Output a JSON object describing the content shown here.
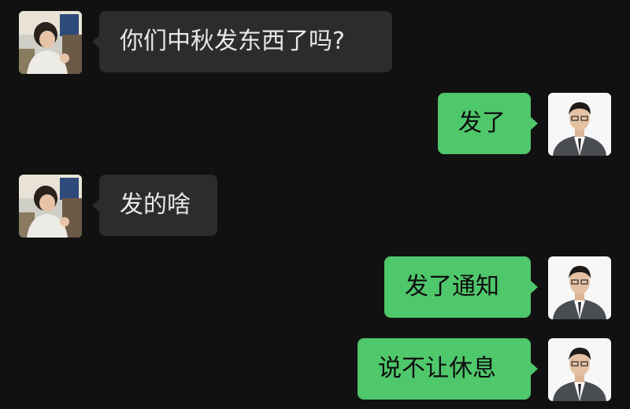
{
  "messages": [
    {
      "sender": "left",
      "text": "你们中秋发东西了吗?"
    },
    {
      "sender": "right",
      "text": "发了"
    },
    {
      "sender": "left",
      "text": "发的啥"
    },
    {
      "sender": "right",
      "text": "发了通知"
    },
    {
      "sender": "right",
      "text": "说不让休息"
    }
  ],
  "colors": {
    "background": "#111111",
    "incoming_bubble": "#2c2c2c",
    "outgoing_bubble": "#4fc76b"
  }
}
